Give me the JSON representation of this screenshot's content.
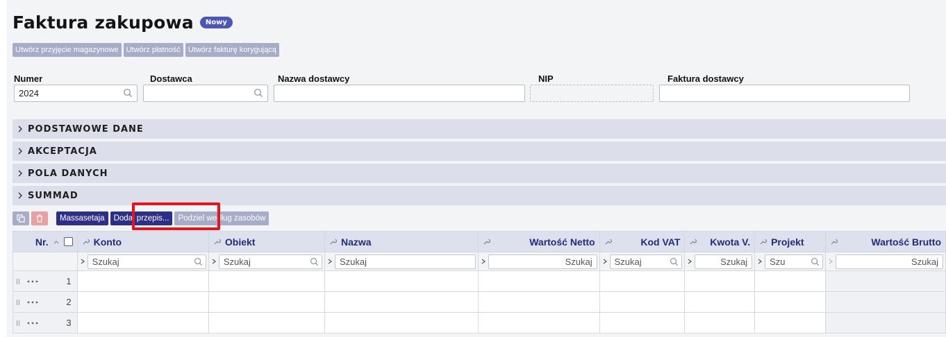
{
  "header": {
    "title": "Faktura zakupowa",
    "badge": "Nowy"
  },
  "actions": [
    "Utwórz przyjęcie magazynowe",
    "Utwórz płatność",
    "Utwórz fakturę korygującą"
  ],
  "fields": {
    "numer_label": "Numer",
    "numer_value": "2024",
    "dostawca_label": "Dostawca",
    "dostawca_value": "",
    "nazwa_label": "Nazwa dostawcy",
    "nazwa_value": "",
    "nip_label": "NIP",
    "nip_value": "",
    "faktura_label": "Faktura dostawcy",
    "faktura_value": ""
  },
  "sections": [
    "PODSTAWOWE DANE",
    "AKCEPTACJA",
    "POLA DANYCH",
    "SUMMAD"
  ],
  "toolbar": {
    "mass_label": "Massasetaja",
    "add_rule_label": "Dodaj przepis...",
    "split_label": "Podziel według zasobów"
  },
  "grid": {
    "columns": {
      "nr": "Nr.",
      "konto": "Konto",
      "obiekt": "Obiekt",
      "nazwa": "Nazwa",
      "netto": "Wartość Netto",
      "vat": "Kod VAT",
      "kwota": "Kwota V.",
      "projekt": "Projekt",
      "brutto": "Wartość Brutto"
    },
    "filter": {
      "konto": "Szukaj",
      "obiekt": "Szukaj",
      "nazwa": "Szukaj",
      "netto": "Szukaj",
      "vat": "Szukaj",
      "kwota": "Szukaj",
      "projekt": "Szu",
      "brutto": "Szukaj"
    },
    "rows": [
      "1",
      "2",
      "3"
    ]
  },
  "colors": {
    "accent": "#2b2f8a",
    "button_muted": "#a7acc9",
    "section_bg": "#dcdfea",
    "highlight": "#e8141a"
  }
}
